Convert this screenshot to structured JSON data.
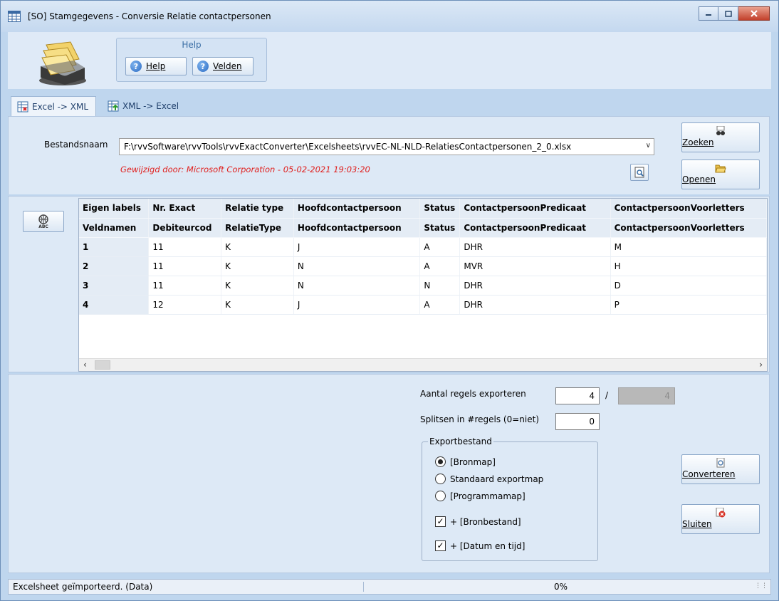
{
  "window": {
    "title": "[SO]  Stamgegevens - Conversie Relatie contactpersonen",
    "icon": "table-icon",
    "controls": [
      "minimize-icon",
      "maximize-icon",
      "close-icon"
    ]
  },
  "toolbar": {
    "group_title": "Help",
    "help_label": "Help",
    "fields_label": "Velden"
  },
  "tabs": [
    {
      "label": "Excel -> XML",
      "active": true
    },
    {
      "label": "XML -> Excel",
      "active": false
    }
  ],
  "file": {
    "label": "Bestandsnaam",
    "path": "F:\\rvvSoftware\\rvvTools\\rvvExactConverter\\Excelsheets\\rvvEC-NL-NLD-RelatiesContactpersonen_2_0.xlsx",
    "modified_text": "Gewijzigd door: Microsoft Corporation   -   05-02-2021  19:03:20",
    "search_label": "Zoeken",
    "open_label": "Openen"
  },
  "grid": {
    "header_labels": [
      "Eigen labels",
      "Nr. Exact",
      "Relatie type",
      "Hoofdcontactpersoon",
      "Status",
      "ContactpersoonPredicaat",
      "ContactpersoonVoorletters"
    ],
    "field_names": [
      "Veldnamen",
      "Debiteurcod",
      "RelatieType",
      "Hoofdcontactpersoon",
      "Status",
      "ContactpersoonPredicaat",
      "ContactpersoonVoorletters"
    ],
    "rows": [
      [
        "1",
        "11",
        "K",
        "J",
        "A",
        "DHR",
        "M"
      ],
      [
        "2",
        "11",
        "K",
        "N",
        "A",
        "MVR",
        "H"
      ],
      [
        "3",
        "11",
        "K",
        "N",
        "N",
        "DHR",
        "D"
      ],
      [
        "4",
        "12",
        "K",
        "J",
        "A",
        "DHR",
        "P"
      ]
    ]
  },
  "export": {
    "rows_label": "Aantal regels exporteren",
    "rows_value": "4",
    "slash": "/",
    "rows_total": "4",
    "split_label": "Splitsen in #regels (0=niet)",
    "split_value": "0",
    "group_title": "Exportbestand",
    "radio_options": [
      "[Bronmap]",
      "Standaard exportmap",
      "[Programmamap]"
    ],
    "selected_radio": "[Bronmap]",
    "checkbox_options": [
      "+ [Bronbestand]",
      "+ [Datum en tijd]"
    ],
    "convert_label": "Converteren",
    "close_label": "Sluiten"
  },
  "status": {
    "message": "Excelsheet geïmporteerd. (Data)",
    "progress": "0%"
  }
}
